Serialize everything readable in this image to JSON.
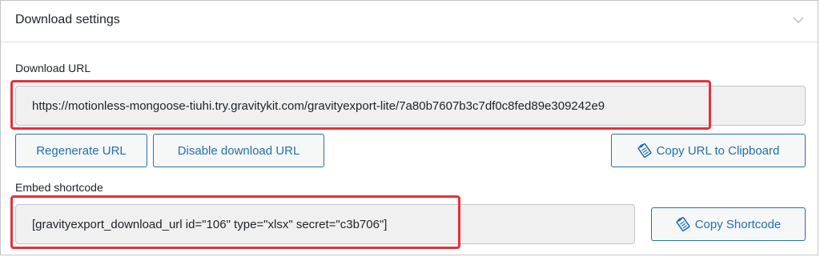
{
  "panel": {
    "title": "Download settings",
    "toggle_icon": "chevron-down-icon"
  },
  "download_url": {
    "label": "Download URL",
    "value": "https://motionless-mongoose-tiuhi.try.gravitykit.com/gravityexport-lite/7a80b7607b3c7df0c8fed89e309242e9",
    "regenerate_label": "Regenerate URL",
    "disable_label": "Disable download URL",
    "copy_label": "Copy URL to Clipboard",
    "copy_icon": "clipboard-icon"
  },
  "shortcode": {
    "label": "Embed shortcode",
    "value": "[gravityexport_download_url id=\"106\" type=\"xlsx\" secret=\"c3b706\"]",
    "copy_label": "Copy Shortcode",
    "copy_icon": "clipboard-icon"
  },
  "colors": {
    "accent": "#2271b1",
    "highlight": "#e8303a",
    "field_bg": "#f0f0f1"
  }
}
